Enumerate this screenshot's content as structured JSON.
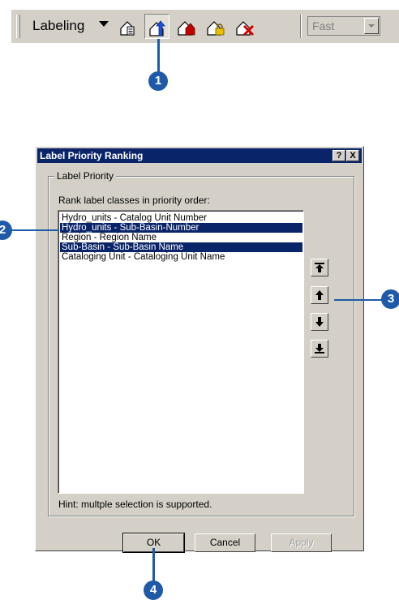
{
  "toolbar": {
    "menu_label": "Labeling",
    "quality_select_value": "Fast",
    "buttons": [
      {
        "icon": "label-manager-icon"
      },
      {
        "icon": "label-priority-ranking-icon",
        "pressed": true
      },
      {
        "icon": "label-weight-ranking-icon"
      },
      {
        "icon": "lock-labels-icon"
      },
      {
        "icon": "pause-labeling-icon"
      }
    ]
  },
  "callouts": {
    "c1": "1",
    "c2": "2",
    "c3": "3",
    "c4": "4"
  },
  "dialog": {
    "title": "Label Priority Ranking",
    "help_button": "?",
    "close_button": "X",
    "group_title": "Label Priority",
    "instruction": "Rank label classes in priority order:",
    "items": [
      {
        "label": "Hydro_units - Catalog Unit Number",
        "selected": false
      },
      {
        "label": "Hydro_units - Sub-Basin-Number",
        "selected": true
      },
      {
        "label": "Region - Region Name",
        "selected": false
      },
      {
        "label": "Sub-Basin - Sub-Basin Name",
        "selected": true
      },
      {
        "label": "Cataloging Unit - Cataloging Unit Name",
        "selected": false
      }
    ],
    "hint": "Hint: multple selection is supported.",
    "ok_label": "OK",
    "cancel_label": "Cancel",
    "apply_label": "Apply"
  },
  "colors": {
    "callout": "#1e5aa8",
    "selection": "#0a246a",
    "face": "#d4d0c8"
  }
}
